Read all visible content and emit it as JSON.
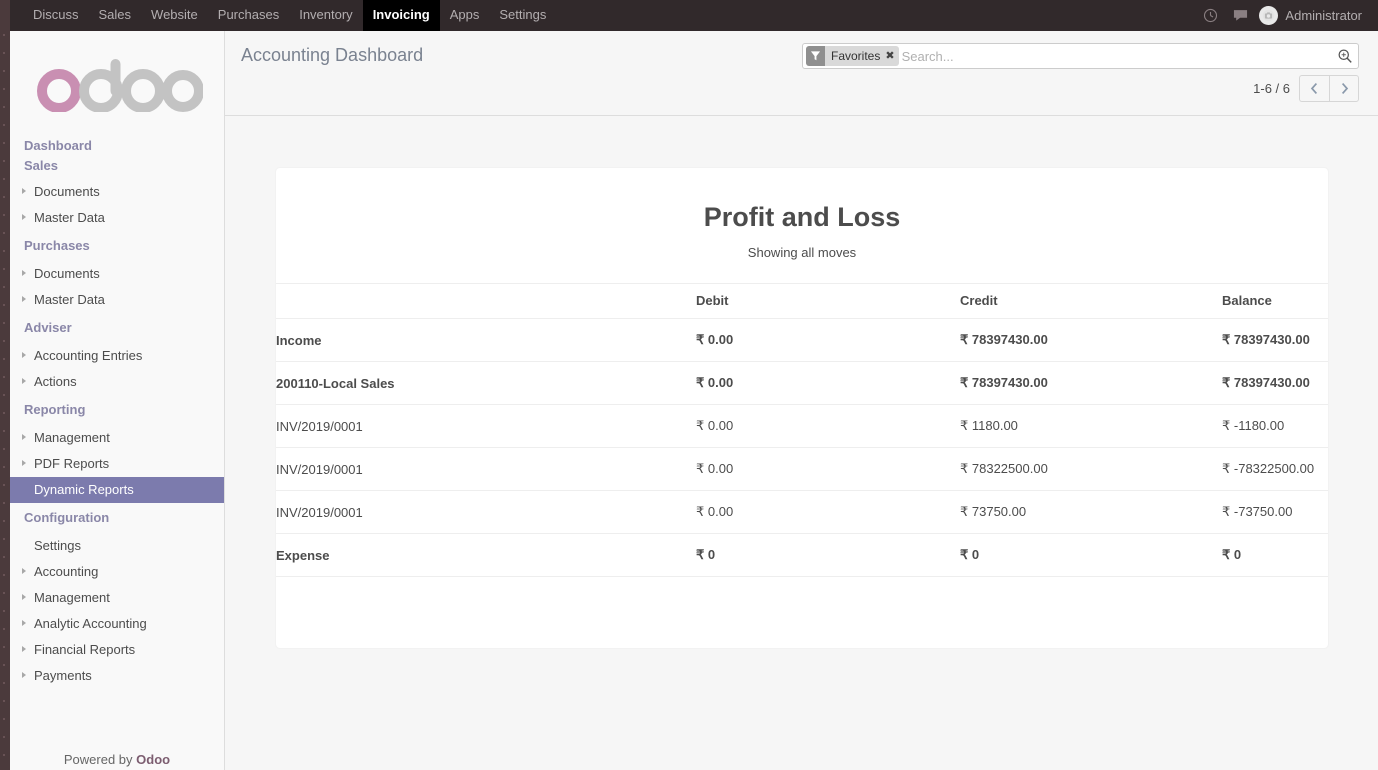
{
  "navbar": {
    "menu_items": [
      {
        "label": "Discuss",
        "active": false
      },
      {
        "label": "Sales",
        "active": false
      },
      {
        "label": "Website",
        "active": false
      },
      {
        "label": "Purchases",
        "active": false
      },
      {
        "label": "Inventory",
        "active": false
      },
      {
        "label": "Invoicing",
        "active": true
      },
      {
        "label": "Apps",
        "active": false
      },
      {
        "label": "Settings",
        "active": false
      }
    ],
    "activity_icon": "clock-icon",
    "messaging_icon": "chat-bubble-icon",
    "avatar_icon": "user-avatar",
    "username": "Administrator"
  },
  "sidebar": {
    "logo_text": "odoo",
    "logo_accent_color": "#c98fb2",
    "logo_gray_color": "#c3c3c3",
    "groups": [
      {
        "title": "Dashboard",
        "subtitle": "Sales",
        "items": [
          {
            "label": "Documents",
            "caret": true,
            "active": false
          },
          {
            "label": "Master Data",
            "caret": true,
            "active": false
          }
        ]
      },
      {
        "title": "Purchases",
        "items": [
          {
            "label": "Documents",
            "caret": true,
            "active": false
          },
          {
            "label": "Master Data",
            "caret": true,
            "active": false
          }
        ]
      },
      {
        "title": "Adviser",
        "items": [
          {
            "label": "Accounting Entries",
            "caret": true,
            "active": false
          },
          {
            "label": "Actions",
            "caret": true,
            "active": false
          }
        ]
      },
      {
        "title": "Reporting",
        "items": [
          {
            "label": "Management",
            "caret": true,
            "active": false
          },
          {
            "label": "PDF Reports",
            "caret": true,
            "active": false
          },
          {
            "label": "Dynamic Reports",
            "caret": false,
            "active": true
          }
        ]
      },
      {
        "title": "Configuration",
        "items": [
          {
            "label": "Settings",
            "caret": false,
            "active": false
          },
          {
            "label": "Accounting",
            "caret": true,
            "active": false
          },
          {
            "label": "Management",
            "caret": true,
            "active": false
          },
          {
            "label": "Analytic Accounting",
            "caret": true,
            "active": false
          },
          {
            "label": "Financial Reports",
            "caret": true,
            "active": false
          },
          {
            "label": "Payments",
            "caret": true,
            "active": false
          }
        ]
      }
    ],
    "footer_prefix": "Powered by ",
    "footer_brand": "Odoo",
    "active_item_color": "#7c7bad"
  },
  "control_panel": {
    "page_title": "Accounting Dashboard",
    "search": {
      "facet_icon": "filter-funnel-icon",
      "facet_label": "Favorites",
      "facet_close": "✖",
      "placeholder": "Search...",
      "value": "",
      "search_icon": "magnifier-icon"
    },
    "pager": {
      "label": "1-6 / 6",
      "prev_icon": "chevron-left-icon",
      "next_icon": "chevron-right-icon"
    }
  },
  "report": {
    "title": "Profit and Loss",
    "subtitle": "Showing all moves",
    "currency": "₹",
    "columns": [
      "",
      "Debit",
      "Credit",
      "Balance"
    ],
    "rows": [
      {
        "level": 0,
        "name": "Income",
        "debit": "₹ 0.00",
        "credit": "₹ 78397430.00",
        "balance": "₹ 78397430.00"
      },
      {
        "level": 1,
        "name": "200110-Local Sales",
        "debit": "₹ 0.00",
        "credit": "₹ 78397430.00",
        "balance": "₹ 78397430.00"
      },
      {
        "level": 2,
        "name": "INV/2019/0001",
        "debit": "₹ 0.00",
        "credit": "₹ 1180.00",
        "balance": "₹ -1180.00"
      },
      {
        "level": 2,
        "name": "INV/2019/0001",
        "debit": "₹ 0.00",
        "credit": "₹ 78322500.00",
        "balance": "₹ -78322500.00"
      },
      {
        "level": 2,
        "name": "INV/2019/0001",
        "debit": "₹ 0.00",
        "credit": "₹ 73750.00",
        "balance": "₹ -73750.00"
      },
      {
        "level": 0,
        "name": "Expense",
        "debit": "₹ 0",
        "credit": "₹ 0",
        "balance": "₹ 0"
      }
    ]
  }
}
